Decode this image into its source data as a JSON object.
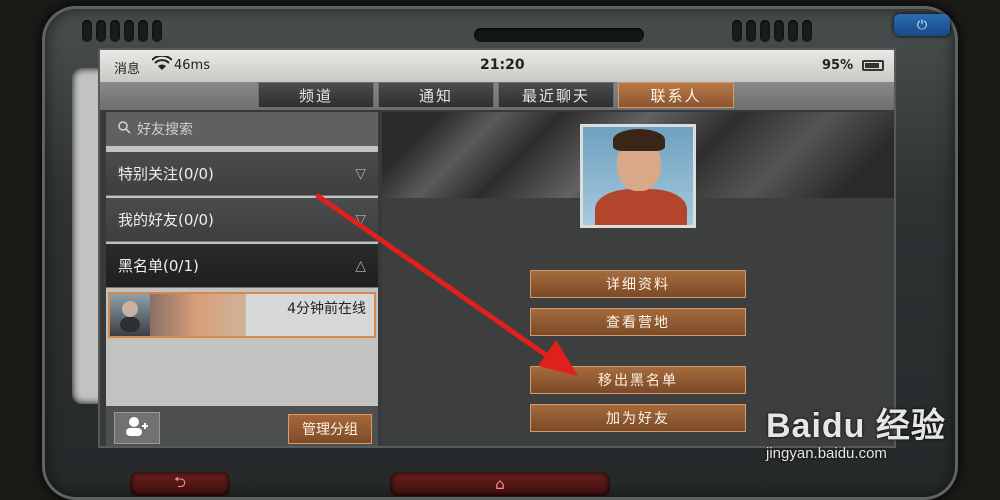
{
  "device": {
    "power_icon": "⏻",
    "back_icon": "⮌",
    "home_icon": "⌂"
  },
  "status": {
    "signal_label": "消息",
    "wifi_icon": "wifi-icon",
    "ping": "46ms",
    "time": "21:20",
    "battery": "95%"
  },
  "tabs": [
    {
      "label": "频道"
    },
    {
      "label": "通知"
    },
    {
      "label": "最近聊天"
    },
    {
      "label": "联系人",
      "active": true
    }
  ],
  "sidebar": {
    "search_placeholder": "好友搜索",
    "groups": [
      {
        "label": "特别关注(0/0)",
        "chevron": "▽"
      },
      {
        "label": "我的好友(0/0)",
        "chevron": "▽"
      },
      {
        "label": "黑名单(0/1)",
        "chevron": "△"
      }
    ],
    "friend": {
      "last_online": "4分钟前在线"
    },
    "add_icon": "add-friend-icon",
    "manage_label": "管理分组"
  },
  "detail": {
    "actions": [
      "详细资料",
      "查看营地",
      "移出黑名单",
      "加为好友"
    ]
  },
  "watermark": {
    "logo": "Baidu 经验",
    "url": "jingyan.baidu.com"
  }
}
